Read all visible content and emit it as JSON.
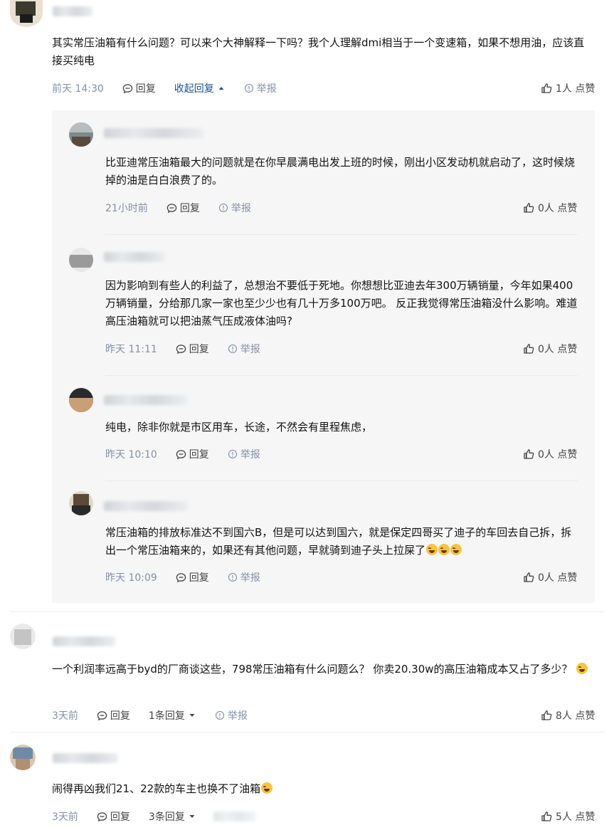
{
  "comments": [
    {
      "text": "其实常压油箱有什么问题？可以来个大神解释一下吗？我个人理解dmi相当于一个变速箱，如果不想用油，应该直接买纯电",
      "time": "前天 14:30",
      "reply": "回复",
      "collapse": "收起回复",
      "report": "举报",
      "likes": "1人 点赞",
      "replies": [
        {
          "text": "比亚迪常压油箱最大的问题就是在你早晨满电出发上班的时候，刚出小区发动机就启动了，这时候烧掉的油是白白浪费了的。",
          "time": "21小时前",
          "reply": "回复",
          "report": "举报",
          "likes": "0人 点赞"
        },
        {
          "text": "因为影响到有些人的利益了，总想治不要低于死地。你想想比亚迪去年300万辆销量，今年如果400万辆销量，分给那几家一家也至少少也有几十万多100万吧。 反正我觉得常压油箱没什么影响。难道高压油箱就可以把油蒸气压成液体油吗?",
          "time": "昨天 11:11",
          "reply": "回复",
          "report": "举报",
          "likes": "0人 点赞"
        },
        {
          "text": "纯电，除非你就是市区用车，长途，不然会有里程焦虑，",
          "time": "昨天 10:10",
          "reply": "回复",
          "report": "举报",
          "likes": "0人 点赞"
        },
        {
          "text": "常压油箱的排放标准达不到国六B，但是可以达到国六，就是保定四哥买了迪子的车回去自己拆，拆出一个常压油箱来的，如果还有其他问题，早就骑到迪子头上拉屎了",
          "time": "昨天 10:09",
          "reply": "回复",
          "report": "举报",
          "likes": "0人 点赞"
        }
      ]
    },
    {
      "text": "一个利润率远高于byd的厂商谈这些，798常压油箱有什么问题么？ 你卖20.30w的高压油箱成本又占了多少？",
      "time": "3天前",
      "reply": "回复",
      "more": "1条回复",
      "report": "举报",
      "likes": "8人 点赞"
    },
    {
      "text": "闹得再凶我们21、22款的车主也换不了油箱",
      "time": "3天前",
      "reply": "回复",
      "more": "3条回复",
      "likes": "5人 点赞"
    }
  ],
  "colors": {
    "link": "#175199",
    "meta": "#8590a6",
    "text": "#121212",
    "subbg": "#f6f6f6"
  }
}
